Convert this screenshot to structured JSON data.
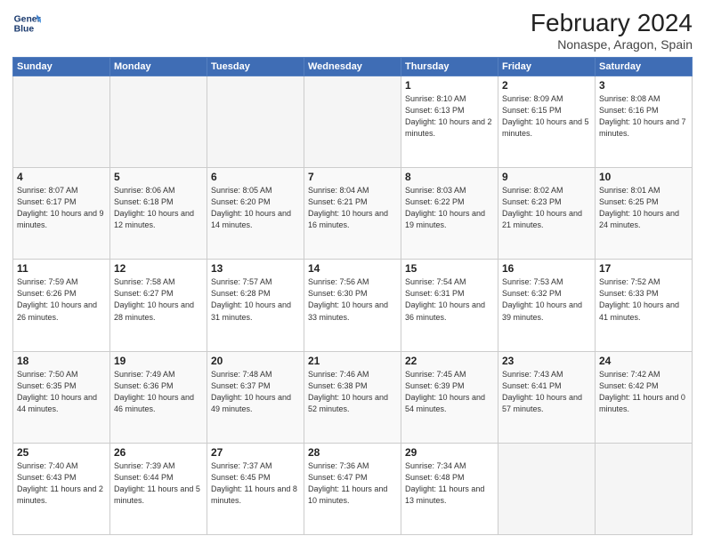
{
  "header": {
    "logo_line1": "General",
    "logo_line2": "Blue",
    "main_title": "February 2024",
    "subtitle": "Nonaspe, Aragon, Spain"
  },
  "days_of_week": [
    "Sunday",
    "Monday",
    "Tuesday",
    "Wednesday",
    "Thursday",
    "Friday",
    "Saturday"
  ],
  "weeks": [
    [
      {
        "day": "",
        "info": ""
      },
      {
        "day": "",
        "info": ""
      },
      {
        "day": "",
        "info": ""
      },
      {
        "day": "",
        "info": ""
      },
      {
        "day": "1",
        "info": "Sunrise: 8:10 AM\nSunset: 6:13 PM\nDaylight: 10 hours\nand 2 minutes."
      },
      {
        "day": "2",
        "info": "Sunrise: 8:09 AM\nSunset: 6:15 PM\nDaylight: 10 hours\nand 5 minutes."
      },
      {
        "day": "3",
        "info": "Sunrise: 8:08 AM\nSunset: 6:16 PM\nDaylight: 10 hours\nand 7 minutes."
      }
    ],
    [
      {
        "day": "4",
        "info": "Sunrise: 8:07 AM\nSunset: 6:17 PM\nDaylight: 10 hours\nand 9 minutes."
      },
      {
        "day": "5",
        "info": "Sunrise: 8:06 AM\nSunset: 6:18 PM\nDaylight: 10 hours\nand 12 minutes."
      },
      {
        "day": "6",
        "info": "Sunrise: 8:05 AM\nSunset: 6:20 PM\nDaylight: 10 hours\nand 14 minutes."
      },
      {
        "day": "7",
        "info": "Sunrise: 8:04 AM\nSunset: 6:21 PM\nDaylight: 10 hours\nand 16 minutes."
      },
      {
        "day": "8",
        "info": "Sunrise: 8:03 AM\nSunset: 6:22 PM\nDaylight: 10 hours\nand 19 minutes."
      },
      {
        "day": "9",
        "info": "Sunrise: 8:02 AM\nSunset: 6:23 PM\nDaylight: 10 hours\nand 21 minutes."
      },
      {
        "day": "10",
        "info": "Sunrise: 8:01 AM\nSunset: 6:25 PM\nDaylight: 10 hours\nand 24 minutes."
      }
    ],
    [
      {
        "day": "11",
        "info": "Sunrise: 7:59 AM\nSunset: 6:26 PM\nDaylight: 10 hours\nand 26 minutes."
      },
      {
        "day": "12",
        "info": "Sunrise: 7:58 AM\nSunset: 6:27 PM\nDaylight: 10 hours\nand 28 minutes."
      },
      {
        "day": "13",
        "info": "Sunrise: 7:57 AM\nSunset: 6:28 PM\nDaylight: 10 hours\nand 31 minutes."
      },
      {
        "day": "14",
        "info": "Sunrise: 7:56 AM\nSunset: 6:30 PM\nDaylight: 10 hours\nand 33 minutes."
      },
      {
        "day": "15",
        "info": "Sunrise: 7:54 AM\nSunset: 6:31 PM\nDaylight: 10 hours\nand 36 minutes."
      },
      {
        "day": "16",
        "info": "Sunrise: 7:53 AM\nSunset: 6:32 PM\nDaylight: 10 hours\nand 39 minutes."
      },
      {
        "day": "17",
        "info": "Sunrise: 7:52 AM\nSunset: 6:33 PM\nDaylight: 10 hours\nand 41 minutes."
      }
    ],
    [
      {
        "day": "18",
        "info": "Sunrise: 7:50 AM\nSunset: 6:35 PM\nDaylight: 10 hours\nand 44 minutes."
      },
      {
        "day": "19",
        "info": "Sunrise: 7:49 AM\nSunset: 6:36 PM\nDaylight: 10 hours\nand 46 minutes."
      },
      {
        "day": "20",
        "info": "Sunrise: 7:48 AM\nSunset: 6:37 PM\nDaylight: 10 hours\nand 49 minutes."
      },
      {
        "day": "21",
        "info": "Sunrise: 7:46 AM\nSunset: 6:38 PM\nDaylight: 10 hours\nand 52 minutes."
      },
      {
        "day": "22",
        "info": "Sunrise: 7:45 AM\nSunset: 6:39 PM\nDaylight: 10 hours\nand 54 minutes."
      },
      {
        "day": "23",
        "info": "Sunrise: 7:43 AM\nSunset: 6:41 PM\nDaylight: 10 hours\nand 57 minutes."
      },
      {
        "day": "24",
        "info": "Sunrise: 7:42 AM\nSunset: 6:42 PM\nDaylight: 11 hours\nand 0 minutes."
      }
    ],
    [
      {
        "day": "25",
        "info": "Sunrise: 7:40 AM\nSunset: 6:43 PM\nDaylight: 11 hours\nand 2 minutes."
      },
      {
        "day": "26",
        "info": "Sunrise: 7:39 AM\nSunset: 6:44 PM\nDaylight: 11 hours\nand 5 minutes."
      },
      {
        "day": "27",
        "info": "Sunrise: 7:37 AM\nSunset: 6:45 PM\nDaylight: 11 hours\nand 8 minutes."
      },
      {
        "day": "28",
        "info": "Sunrise: 7:36 AM\nSunset: 6:47 PM\nDaylight: 11 hours\nand 10 minutes."
      },
      {
        "day": "29",
        "info": "Sunrise: 7:34 AM\nSunset: 6:48 PM\nDaylight: 11 hours\nand 13 minutes."
      },
      {
        "day": "",
        "info": ""
      },
      {
        "day": "",
        "info": ""
      }
    ]
  ]
}
